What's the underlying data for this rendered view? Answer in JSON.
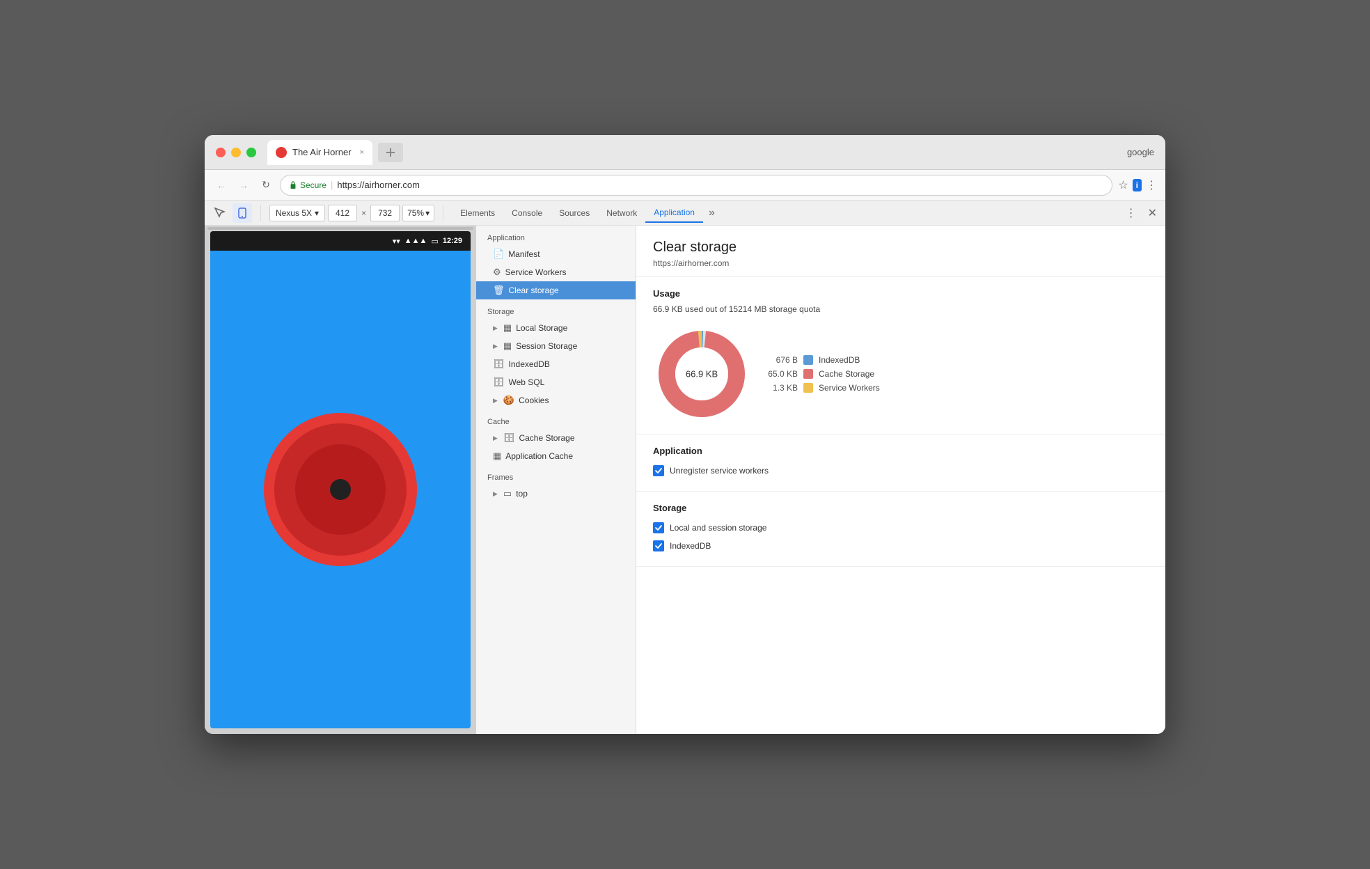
{
  "browser": {
    "profile": "google",
    "tab": {
      "title": "The Air Horner",
      "favicon_color": "#e53935",
      "close_label": "×"
    },
    "address": {
      "secure_text": "Secure",
      "url_prefix": "https://",
      "url_domain": "airhorner.com"
    },
    "nav": {
      "back": "←",
      "forward": "→",
      "refresh": "↻"
    }
  },
  "devtools": {
    "device": "Nexus 5X",
    "width": "412",
    "height": "732",
    "zoom": "75%",
    "tabs": [
      "Elements",
      "Console",
      "Sources",
      "Network",
      "Application"
    ],
    "active_tab": "Application"
  },
  "sidebar": {
    "application_label": "Application",
    "items_application": [
      {
        "id": "manifest",
        "label": "Manifest",
        "icon": "📄"
      },
      {
        "id": "service-workers",
        "label": "Service Workers",
        "icon": "⚙️"
      },
      {
        "id": "clear-storage",
        "label": "Clear storage",
        "icon": "🗑",
        "active": true
      }
    ],
    "storage_label": "Storage",
    "items_storage": [
      {
        "id": "local-storage",
        "label": "Local Storage",
        "icon": "▦",
        "expandable": true
      },
      {
        "id": "session-storage",
        "label": "Session Storage",
        "icon": "▦",
        "expandable": true
      },
      {
        "id": "indexed-db",
        "label": "IndexedDB",
        "icon": "🗄"
      },
      {
        "id": "web-sql",
        "label": "Web SQL",
        "icon": "🗄"
      },
      {
        "id": "cookies",
        "label": "Cookies",
        "icon": "🍪",
        "expandable": true
      }
    ],
    "cache_label": "Cache",
    "items_cache": [
      {
        "id": "cache-storage",
        "label": "Cache Storage",
        "icon": "🗄",
        "expandable": true
      },
      {
        "id": "application-cache",
        "label": "Application Cache",
        "icon": "▦"
      }
    ],
    "frames_label": "Frames",
    "items_frames": [
      {
        "id": "top",
        "label": "top",
        "icon": "▭",
        "expandable": true
      }
    ]
  },
  "panel": {
    "title": "Clear storage",
    "subtitle": "https://airhorner.com",
    "usage_section": {
      "title": "Usage",
      "description": "66.9 KB used out of 15214 MB storage quota",
      "total_label": "66.9 KB",
      "chart": {
        "indexed_db_value": "676 B",
        "indexed_db_color": "#5b9bd5",
        "indexed_db_label": "IndexedDB",
        "cache_storage_value": "65.0 KB",
        "cache_storage_color": "#e07070",
        "cache_storage_label": "Cache Storage",
        "service_workers_value": "1.3 KB",
        "service_workers_color": "#f0c050",
        "service_workers_label": "Service Workers"
      }
    },
    "application_section": {
      "title": "Application",
      "items": [
        {
          "id": "unregister-sw",
          "label": "Unregister service workers",
          "checked": true
        }
      ]
    },
    "storage_section": {
      "title": "Storage",
      "items": [
        {
          "id": "local-session",
          "label": "Local and session storage",
          "checked": true
        },
        {
          "id": "indexed-db",
          "label": "IndexedDB",
          "checked": true
        }
      ]
    }
  }
}
